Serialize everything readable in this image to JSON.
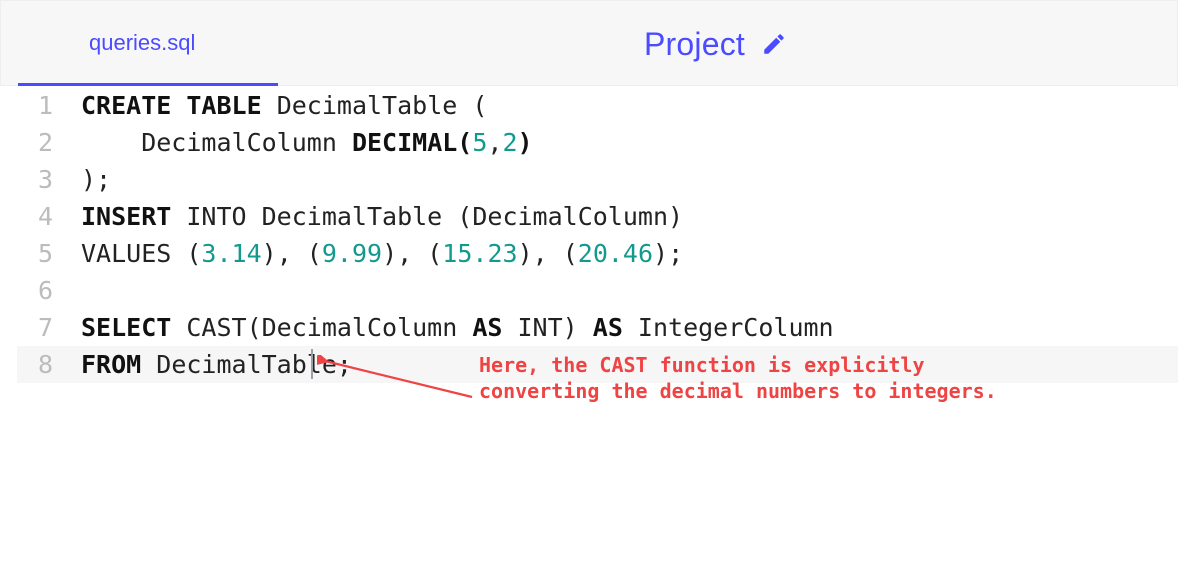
{
  "header": {
    "tab_label": "queries.sql",
    "project_label": "Project"
  },
  "editor": {
    "lines": [
      {
        "n": "1"
      },
      {
        "n": "2"
      },
      {
        "n": "3"
      },
      {
        "n": "4"
      },
      {
        "n": "5"
      },
      {
        "n": "6"
      },
      {
        "n": "7"
      },
      {
        "n": "8"
      }
    ],
    "l1_kw1": "CREATE",
    "l1_kw2": "TABLE",
    "l1_rest": " DecimalTable (",
    "l2_indent": "    DecimalColumn ",
    "l2_kw": "DECIMAL(",
    "l2_num1": "5",
    "l2_comma": ",",
    "l2_num2": "2",
    "l2_close": ")",
    "l3": ");",
    "l4_kw": "INSERT",
    "l4_rest": " INTO DecimalTable (DecimalColumn)",
    "l5_pre": "VALUES (",
    "l5_n1": "3.14",
    "l5_s1": "), (",
    "l5_n2": "9.99",
    "l5_s2": "), (",
    "l5_n3": "15.23",
    "l5_s3": "), (",
    "l5_n4": "20.46",
    "l5_s4": ");",
    "l7_kw1": "SELECT",
    "l7_mid1": " CAST(DecimalColumn ",
    "l7_kw2": "AS",
    "l7_mid2": " INT) ",
    "l7_kw3": "AS",
    "l7_mid3": " IntegerColumn",
    "l8_kw": "FROM",
    "l8_rest": " DecimalTable;"
  },
  "annotation": {
    "line1": "Here, the CAST function is explicitly",
    "line2": "converting the decimal numbers to integers."
  }
}
